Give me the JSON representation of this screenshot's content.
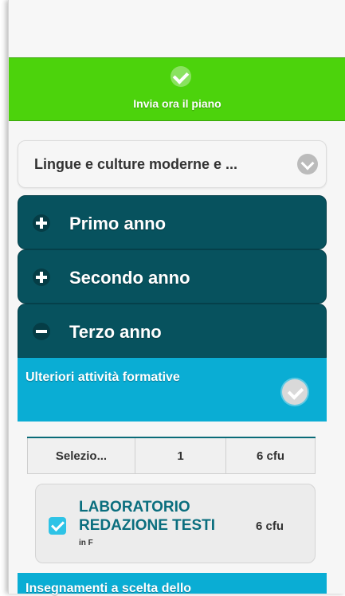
{
  "submit": {
    "label": "Invia ora il piano",
    "icon": "check-icon"
  },
  "course": {
    "name": "Lingue e culture moderne e ...",
    "icon": "chevron-down-icon"
  },
  "years": [
    {
      "label": "Primo anno",
      "state": "collapsed"
    },
    {
      "label": "Secondo anno",
      "state": "collapsed"
    },
    {
      "label": "Terzo anno",
      "state": "expanded"
    }
  ],
  "activities": {
    "title": "Ulteriori attività formative",
    "icon": "check-circle-icon"
  },
  "summary": {
    "selection": "Selezio...",
    "count": "1",
    "credits": "6 cfu"
  },
  "card": {
    "title": "LABORATORIO REDAZIONE TESTI",
    "sub": "in F",
    "credits": "6 cfu",
    "checked": true
  },
  "next_section": {
    "title": "Insegnamenti a scelta dello"
  },
  "colors": {
    "submit_bar": "#4cd30c",
    "year_header": "#07525e",
    "section_header": "#0aadd4",
    "card_title": "#0a6e7e"
  }
}
